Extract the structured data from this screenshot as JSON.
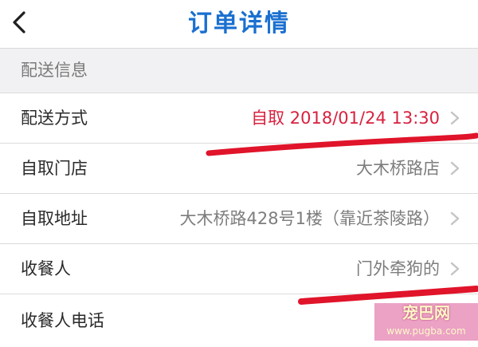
{
  "header": {
    "title": "订单详情",
    "back_icon": "chevron-left-icon"
  },
  "section": {
    "title": "配送信息"
  },
  "rows": [
    {
      "label": "配送方式",
      "value": "自取 2018/01/24 13:30",
      "accent": true
    },
    {
      "label": "自取门店",
      "value": "大木桥路店"
    },
    {
      "label": "自取地址",
      "value": "大木桥路428号1楼（靠近茶陵路）"
    },
    {
      "label": "收餐人",
      "value": "门外牵狗的"
    },
    {
      "label": "收餐人电话",
      "value": ""
    }
  ],
  "watermark": {
    "text": "宠巴网",
    "url": "www.pugba.com"
  },
  "colors": {
    "title": "#1a6fd0",
    "accent": "#d8213f",
    "annotation": "#e0142a"
  }
}
